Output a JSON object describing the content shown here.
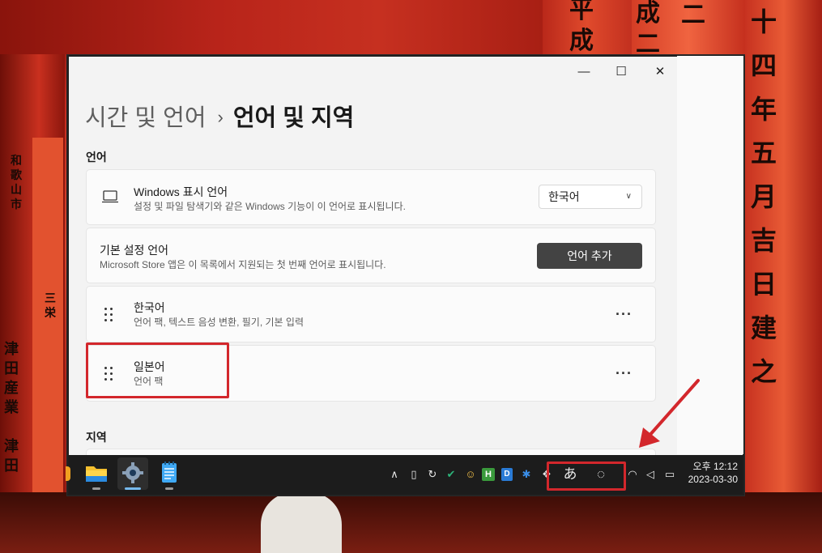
{
  "window": {
    "controls": {
      "minimize": "—",
      "maximize": "☐",
      "close": "✕"
    }
  },
  "breadcrumb": {
    "parent": "시간 및 언어",
    "separator": "›",
    "current": "언어 및 지역"
  },
  "language_section": {
    "label": "언어",
    "display_language": {
      "title": "Windows 표시 언어",
      "subtitle": "설정 및 파일 탐색기와 같은 Windows 기능이 이 언어로 표시됩니다.",
      "selected": "한국어"
    },
    "preferred_languages": {
      "title": "기본 설정 언어",
      "subtitle": "Microsoft Store 앱은 이 목록에서 지원되는 첫 번째 언어로 표시됩니다.",
      "add_button": "언어 추가"
    },
    "languages": [
      {
        "name": "한국어",
        "features": "언어 팩, 텍스트 음성 변환, 필기, 기본 입력"
      },
      {
        "name": "일본어",
        "features": "언어 팩"
      }
    ],
    "more_glyph": "···"
  },
  "region_section": {
    "label": "지역"
  },
  "taskbar": {
    "apps": [
      "file-explorer",
      "settings",
      "notepad"
    ],
    "tray": {
      "ime_mode": "あ",
      "ime_indicator": "◌"
    },
    "clock": {
      "time": "오후 12:12",
      "date": "2023-03-30"
    }
  },
  "wallpaper_text": {
    "columns": [
      "平成二十",
      "成二",
      "二",
      "十四年五月吉日建之",
      "和歌山市",
      "三栄",
      "津田産業",
      "津田"
    ]
  },
  "colors": {
    "highlight": "#d3272c",
    "accent_button": "#434343",
    "taskbar": "#1c1c1c"
  }
}
